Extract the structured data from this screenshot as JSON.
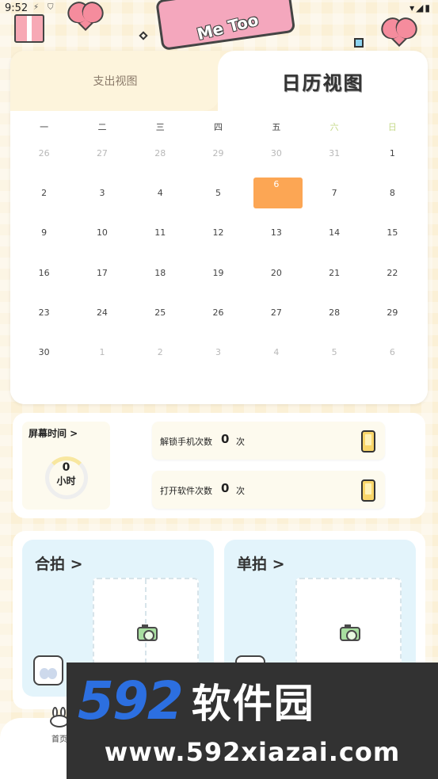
{
  "status_bar": {
    "time": "9:52",
    "right_icons": "▾◢▮"
  },
  "header": {
    "decor_text": "Me Too"
  },
  "tabs": {
    "expense_view": "支出视图",
    "calendar_view": "日历视图"
  },
  "calendar": {
    "weekdays": [
      "一",
      "二",
      "三",
      "四",
      "五",
      "六",
      "日"
    ],
    "weeks": [
      [
        {
          "d": "26",
          "other": true
        },
        {
          "d": "27",
          "other": true
        },
        {
          "d": "28",
          "other": true
        },
        {
          "d": "29",
          "other": true
        },
        {
          "d": "30",
          "other": true
        },
        {
          "d": "31",
          "other": true
        },
        {
          "d": "1",
          "other": false
        }
      ],
      [
        {
          "d": "2",
          "other": false
        },
        {
          "d": "3",
          "other": false
        },
        {
          "d": "4",
          "other": false
        },
        {
          "d": "5",
          "other": false
        },
        {
          "d": "6",
          "other": false,
          "today": true
        },
        {
          "d": "7",
          "other": false
        },
        {
          "d": "8",
          "other": false
        }
      ],
      [
        {
          "d": "9",
          "other": false
        },
        {
          "d": "10",
          "other": false
        },
        {
          "d": "11",
          "other": false
        },
        {
          "d": "12",
          "other": false
        },
        {
          "d": "13",
          "other": false
        },
        {
          "d": "14",
          "other": false
        },
        {
          "d": "15",
          "other": false
        }
      ],
      [
        {
          "d": "16",
          "other": false
        },
        {
          "d": "17",
          "other": false
        },
        {
          "d": "18",
          "other": false
        },
        {
          "d": "19",
          "other": false
        },
        {
          "d": "20",
          "other": false
        },
        {
          "d": "21",
          "other": false
        },
        {
          "d": "22",
          "other": false
        }
      ],
      [
        {
          "d": "23",
          "other": false
        },
        {
          "d": "24",
          "other": false
        },
        {
          "d": "25",
          "other": false
        },
        {
          "d": "26",
          "other": false
        },
        {
          "d": "27",
          "other": false
        },
        {
          "d": "28",
          "other": false
        },
        {
          "d": "29",
          "other": false
        }
      ],
      [
        {
          "d": "30",
          "other": false
        },
        {
          "d": "1",
          "other": true
        },
        {
          "d": "2",
          "other": true
        },
        {
          "d": "3",
          "other": true
        },
        {
          "d": "4",
          "other": true
        },
        {
          "d": "5",
          "other": true
        },
        {
          "d": "6",
          "other": true
        }
      ]
    ],
    "today_color": "#fca654"
  },
  "screen_time": {
    "label": "屏幕时间 >",
    "value": "0",
    "unit": "小时"
  },
  "stats": {
    "unlock": {
      "label": "解锁手机次数",
      "value": "0",
      "unit": "次"
    },
    "open_app": {
      "label": "打开软件次数",
      "value": "0",
      "unit": "次"
    }
  },
  "photo": {
    "group_title": "合拍 >",
    "single_title": "单拍 >"
  },
  "bottom_nav": {
    "home_label": "首页"
  },
  "watermark": {
    "number": "592",
    "name": "软件园",
    "url": "www.592xiazai.com"
  }
}
